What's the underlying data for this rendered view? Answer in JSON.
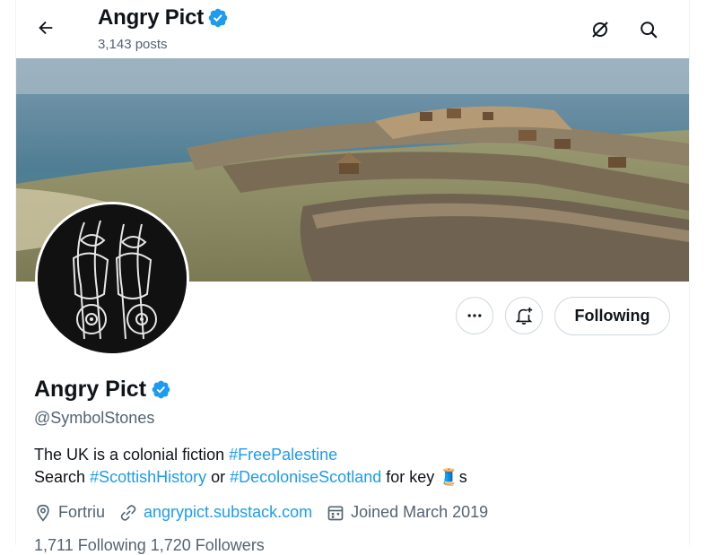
{
  "header": {
    "name": "Angry Pict",
    "posts": "3,143 posts"
  },
  "profile": {
    "name": "Angry Pict",
    "handle": "@SymbolStones",
    "follow_label": "Following",
    "bio": {
      "line1_text": "The UK is a colonial fiction ",
      "line1_tag": "#FreePalestine",
      "line2_prefix": "Search ",
      "line2_tag1": "#ScottishHistory",
      "line2_mid": " or ",
      "line2_tag2": "#DecoloniseScotland",
      "line2_suffix": " for key",
      "line2_emoji": "🧵",
      "line2_end": "s"
    },
    "location": "Fortriu",
    "website": "angrypict.substack.com",
    "joined": "Joined March 2019",
    "counts_partial": "1,711 Following    1,720 Followers"
  },
  "icons": {
    "back": "arrow-left-icon",
    "grok": "grok-slash-icon",
    "search": "search-icon",
    "more": "more-dots-icon",
    "notify": "bell-plus-icon",
    "verified": "verified-badge-icon",
    "location": "location-pin-icon",
    "link": "link-icon",
    "calendar": "calendar-icon"
  },
  "colors": {
    "accent": "#1d9bf0",
    "text": "#0f1419",
    "secondary": "#536471"
  }
}
